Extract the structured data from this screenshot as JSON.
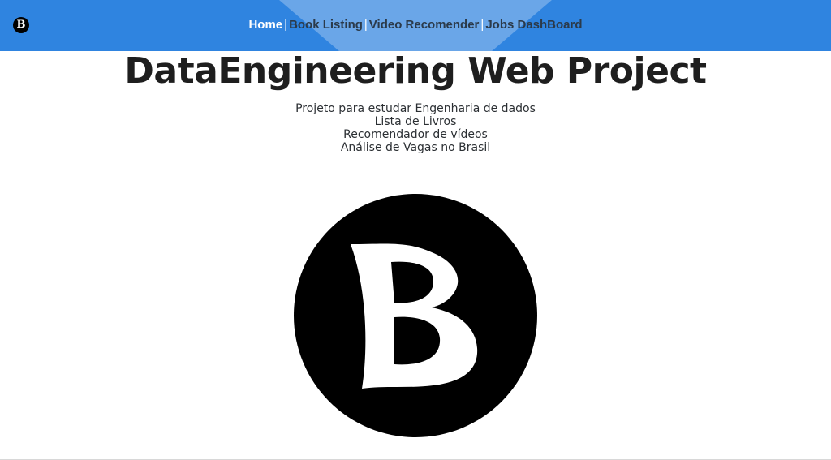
{
  "nav": {
    "logo_letter": "B",
    "links": [
      {
        "label": "Home",
        "active": true
      },
      {
        "label": "Book Listing",
        "active": false
      },
      {
        "label": "Video Recomender",
        "active": false
      },
      {
        "label": "Jobs DashBoard",
        "active": false
      }
    ],
    "separator": "|"
  },
  "main": {
    "title": "DataEngineering Web Project",
    "description_lines": [
      "Projeto para estudar Engenharia de dados",
      "Lista de Livros",
      "Recomendador de vídeos",
      "Análise de Vagas no Brasil"
    ],
    "logo_letter": "B"
  },
  "colors": {
    "navbar": "#2f84e0",
    "nav_highlight": "#6aa6e8",
    "active_link": "#ffffff",
    "inactive_link": "#2b3a4a"
  }
}
